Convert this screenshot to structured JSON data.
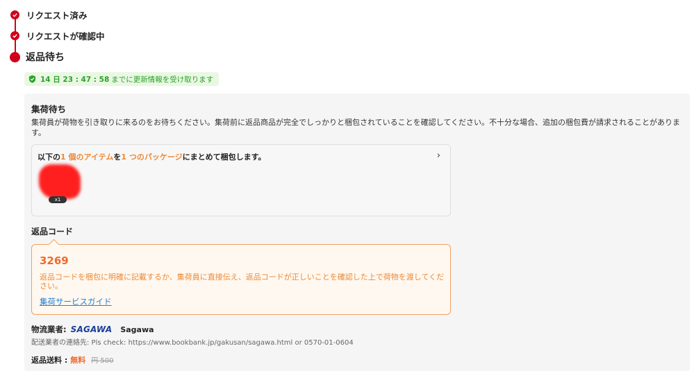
{
  "steps": [
    {
      "label": "リクエスト済み"
    },
    {
      "label": "リクエストが確認中"
    },
    {
      "label": "返品待ち"
    }
  ],
  "countdown": {
    "time": "14 日 23 : 47 : 58",
    "suffix": "までに更新情報を受け取ります"
  },
  "pickup": {
    "title": "集荷待ち",
    "description": "集荷員が荷物を引き取りに来るのをお待ちください。集荷前に返品商品が完全でしっかりと梱包されていることを確認してください。不十分な場合、追加の梱包費が請求されることがあります。"
  },
  "package": {
    "prefix": "以下の",
    "item_count": "1 個のアイテム",
    "mid": "を",
    "package_count": "1 つのパッケージ",
    "suffix": "にまとめて梱包します。",
    "chevron": "›",
    "quantity": "x1"
  },
  "return_code": {
    "title": "返品コード",
    "code": "3269",
    "description": "返品コードを梱包に明確に記載するか、集荷員に直接伝え、返品コードが正しいことを確認した上で荷物を渡してください。",
    "guide_link": "集荷サービスガイド"
  },
  "carrier": {
    "label": "物流業者:",
    "logo_text": "SAGAWA",
    "name": "Sagawa",
    "contact": "配送業者の連絡先: Pls check: https://www.bookbank.jp/gakusan/sagawa.html or 0570-01-0604"
  },
  "fee": {
    "label": "返品送料 :",
    "free": "無料",
    "original": "円 500"
  },
  "colors": {
    "accent_red": "#d0011b",
    "countdown_green": "#29a329",
    "highlight_orange": "#ee8833",
    "link_blue": "#2a7fd0",
    "carrier_blue": "#1b3f9a"
  }
}
